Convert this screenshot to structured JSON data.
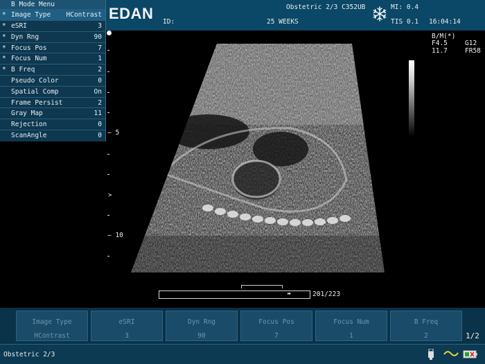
{
  "menu": {
    "title": "B Mode Menu",
    "items": [
      {
        "star": "*",
        "label": "Image Type",
        "value": "HContrast",
        "selected": true
      },
      {
        "star": "*",
        "label": "eSRI",
        "value": "3"
      },
      {
        "star": "*",
        "label": "Dyn Rng",
        "value": "90"
      },
      {
        "star": "*",
        "label": "Focus Pos",
        "value": "7"
      },
      {
        "star": "*",
        "label": "Focus Num",
        "value": "1"
      },
      {
        "star": "*",
        "label": "B Freq",
        "value": "2"
      },
      {
        "star": "",
        "label": "Pseudo Color",
        "value": "0"
      },
      {
        "star": "",
        "label": "Spatial Comp",
        "value": "On"
      },
      {
        "star": "",
        "label": "Frame Persist",
        "value": "2"
      },
      {
        "star": "",
        "label": "Gray Map",
        "value": "11"
      },
      {
        "star": "",
        "label": "Rejection",
        "value": "0"
      },
      {
        "star": "",
        "label": "ScanAngle",
        "value": "0"
      }
    ]
  },
  "header": {
    "logo": "EDAN",
    "id_label": "ID:",
    "exam": "Obstetric 2/3 C352UB",
    "weeks": "25 WEEKS",
    "mi": "MI: 0.4",
    "tis": "TIS 0.1",
    "time": "16:04:14",
    "freeze_icon": "snowflake-icon"
  },
  "image_params": {
    "mode": "B/M(*)",
    "freq": "F4.5",
    "gain": "G12",
    "depth": "11.7",
    "frame_rate": "FR58"
  },
  "depth_scale": {
    "label_5": "5",
    "label_10": "10",
    "focus_marker": ">"
  },
  "cine": {
    "frames": "201/223"
  },
  "softkeys": [
    {
      "label": "Image Type",
      "value": "HContrast"
    },
    {
      "label": "eSRI",
      "value": "3"
    },
    {
      "label": "Dyn Rng",
      "value": "90"
    },
    {
      "label": "Focus Pos",
      "value": "7"
    },
    {
      "label": "Focus Num",
      "value": "1"
    },
    {
      "label": "B Freq",
      "value": "2"
    }
  ],
  "page_indicator": "1/2",
  "status": {
    "text": "Obstetric 2/3",
    "icons": [
      "usb-icon",
      "wave-icon",
      "battery-icon"
    ]
  },
  "colors": {
    "panel": "#0e3850",
    "header": "#0b4766",
    "softkey": "#1a4c69",
    "softkey_text": "#6d95ad"
  }
}
